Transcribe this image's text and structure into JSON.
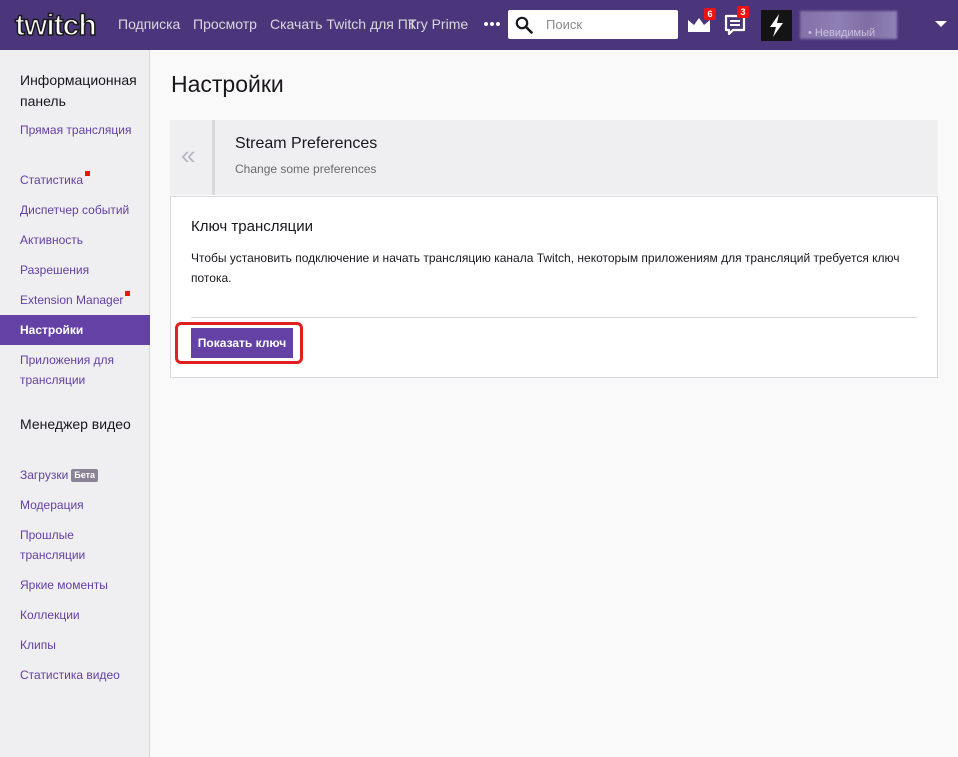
{
  "colors": {
    "brand_purple": "#6441a4",
    "topbar_bg": "#4b367c",
    "badge_red": "#ec1313",
    "highlight_red": "#e02020"
  },
  "topbar": {
    "logo_alt": "twitch",
    "nav": [
      "Подписка",
      "Просмотр",
      "Скачать Twitch для ПК",
      "Try Prime"
    ],
    "more_icon": "more-dots-icon",
    "search": {
      "placeholder": "Поиск",
      "icon": "search-icon"
    },
    "prime_icon": "crown-icon",
    "prime_badge": "6",
    "notifications_icon": "notifications-icon",
    "notifications_badge": "3",
    "user_sub": "• Невидимый",
    "caret_icon": "caret-down-icon"
  },
  "sidebar": {
    "section1_title": "Информационная панель",
    "section1_items": [
      {
        "label": "Прямая трансляция"
      },
      {
        "label": "Статистика",
        "dot": true
      },
      {
        "label": "Диспетчер событий"
      },
      {
        "label": "Активность"
      },
      {
        "label": "Разрешения"
      },
      {
        "label": "Extension Manager",
        "dot": true
      },
      {
        "label": "Настройки",
        "active": true
      },
      {
        "label": "Приложения для трансляции"
      }
    ],
    "section2_title": "Менеджер видео",
    "section2_items": [
      {
        "label": "Загрузки",
        "badge": "Бета"
      },
      {
        "label": "Модерация"
      },
      {
        "label": "Прошлые трансляции"
      },
      {
        "label": "Яркие моменты"
      },
      {
        "label": "Коллекции"
      },
      {
        "label": "Клипы"
      },
      {
        "label": "Статистика видео"
      }
    ]
  },
  "main": {
    "page_title": "Настройки",
    "card_header": {
      "back_glyph": "«",
      "title": "Stream Preferences",
      "subtitle": "Change some preferences"
    },
    "card_body": {
      "title": "Ключ трансляции",
      "description": "Чтобы установить подключение и начать трансляцию канала Twitch, некоторым приложениям для трансляций требуется ключ потока.",
      "button_label": "Показать ключ"
    }
  }
}
